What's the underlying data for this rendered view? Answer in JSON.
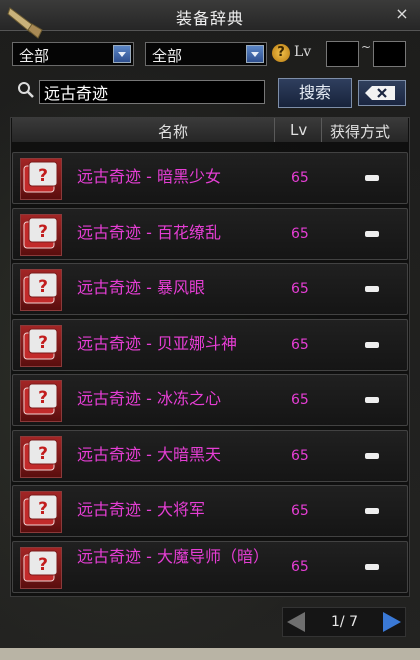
{
  "window": {
    "title": "装备辞典",
    "close_label": "×"
  },
  "filters": {
    "category1": "全部",
    "category2": "全部",
    "help": "?",
    "lv_label": "Lv",
    "lv_min": "",
    "lv_max": "",
    "range_sep": "~"
  },
  "search": {
    "value": "远古奇迹",
    "button_label": "搜索",
    "clear_icon": "backspace-icon"
  },
  "table": {
    "headers": {
      "name": "名称",
      "lv": "Lv",
      "source": "获得方式"
    },
    "rows": [
      {
        "name": "远古奇迹 - 暗黑少女",
        "lv": "65"
      },
      {
        "name": "远古奇迹 - 百花缭乱",
        "lv": "65"
      },
      {
        "name": "远古奇迹 - 暴风眼",
        "lv": "65"
      },
      {
        "name": "远古奇迹 - 贝亚娜斗神",
        "lv": "65"
      },
      {
        "name": "远古奇迹 - 冰冻之心",
        "lv": "65"
      },
      {
        "name": "远古奇迹 - 大暗黑天",
        "lv": "65"
      },
      {
        "name": "远古奇迹 - 大将军",
        "lv": "65"
      },
      {
        "name": "远古奇迹 - 大魔导师（暗）",
        "lv": "65"
      }
    ]
  },
  "pager": {
    "text": "1/ 7"
  },
  "colors": {
    "item_text": "#e53ed4",
    "button_blue": "#3a79d6"
  }
}
